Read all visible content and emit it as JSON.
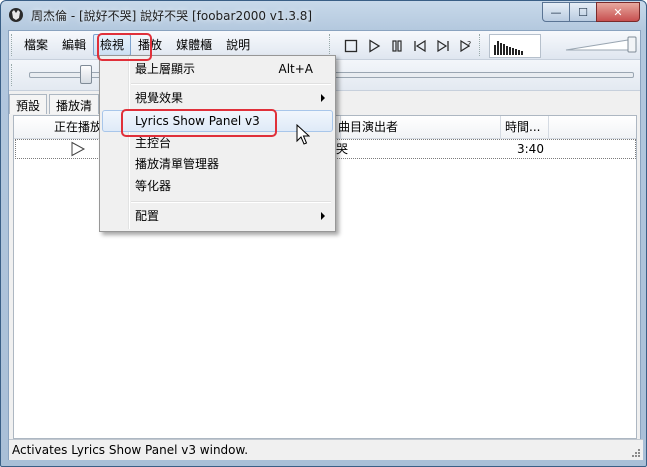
{
  "window": {
    "title": "周杰倫 - [說好不哭] 說好不哭  [foobar2000 v1.3.8]",
    "controls": {
      "minimize": "—",
      "maximize": "☐",
      "close": "✕"
    }
  },
  "menubar": {
    "items": [
      "檔案",
      "編輯",
      "檢視",
      "播放",
      "媒體櫃",
      "說明"
    ],
    "active_index": 2
  },
  "toolbar": {
    "buttons": [
      "stop-icon",
      "play-icon",
      "pause-icon",
      "previous-icon",
      "next-icon",
      "random-icon"
    ]
  },
  "seekbar": {
    "position": 0.1
  },
  "tabs": [
    "預設",
    "播放清"
  ],
  "playlist": {
    "columns": [
      "正在播放",
      "曲目演出者",
      "時間..."
    ],
    "rows": [
      {
        "playing_icon": "play-outline-icon",
        "artist": "哭",
        "time": "3:40"
      }
    ]
  },
  "view_menu": {
    "items": [
      {
        "label": "最上層顯示",
        "shortcut": "Alt+A"
      },
      {
        "label": "視覺效果",
        "submenu": true
      },
      {
        "label": "Lyrics Show Panel v3",
        "highlighted": true
      },
      {
        "label": "主控台"
      },
      {
        "label": "播放清單管理器"
      },
      {
        "label": "等化器"
      },
      {
        "label": "配置",
        "submenu": true
      }
    ]
  },
  "status_bar": {
    "text": "Activates Lyrics Show Panel v3 window."
  },
  "colors": {
    "annotation": "#e0303a",
    "title_bar": "#b3c8de",
    "menu_hover": "#dfeaf8"
  }
}
